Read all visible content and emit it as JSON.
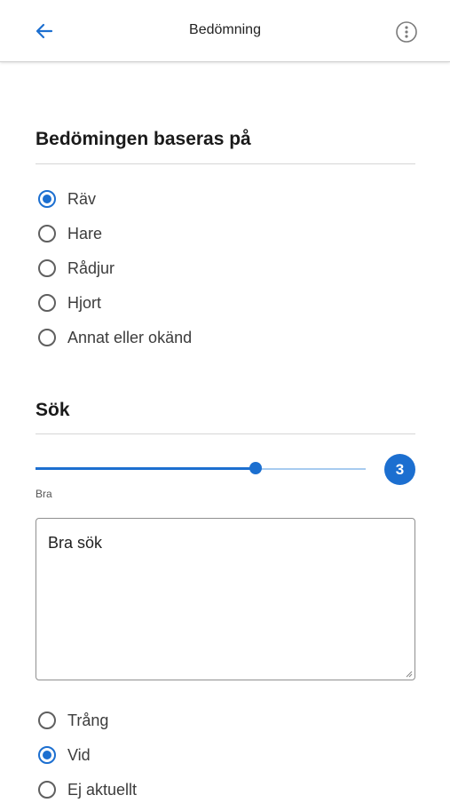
{
  "appbar": {
    "title": "Bedömning",
    "back_icon": "arrow-left-icon",
    "info_icon": "more-vertical-circle-icon"
  },
  "colors": {
    "accent": "#1c6fd0",
    "track_inactive": "#a7cbf0"
  },
  "basis": {
    "title": "Bedömingen baseras på",
    "options": [
      {
        "label": "Räv",
        "checked": true
      },
      {
        "label": "Hare",
        "checked": false
      },
      {
        "label": "Rådjur",
        "checked": false
      },
      {
        "label": "Hjort",
        "checked": false
      },
      {
        "label": "Annat eller okänd",
        "checked": false
      }
    ]
  },
  "search": {
    "title": "Sök",
    "slider": {
      "value": "3",
      "fraction": 0.667,
      "caption": "Bra"
    },
    "comment": "Bra sök",
    "options": [
      {
        "label": "Trång",
        "checked": false
      },
      {
        "label": "Vid",
        "checked": true
      },
      {
        "label": "Ej aktuellt",
        "checked": false
      }
    ]
  }
}
